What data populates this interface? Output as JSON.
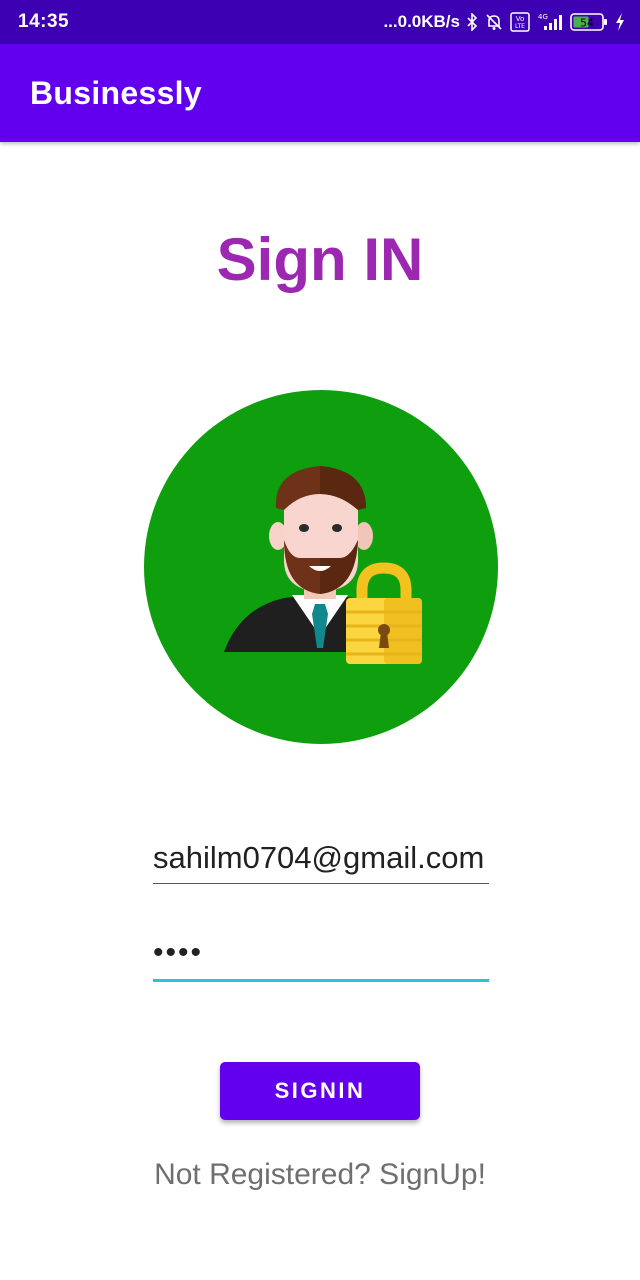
{
  "status_bar": {
    "time": "14:35",
    "net_speed": "...0.0KB/s",
    "battery_level": "54",
    "icons": [
      "bluetooth-icon",
      "silent-bell-icon",
      "volte-icon",
      "4g-signal-icon",
      "battery-icon",
      "charging-icon"
    ]
  },
  "app_bar": {
    "title": "Businessly",
    "color": "#6200ee"
  },
  "main": {
    "title": "Sign IN",
    "title_color": "#9c27b0",
    "avatar_icon": "businessman-lock-icon",
    "avatar_bg": "#0e9e0e",
    "email_value": "sahilm0704@gmail.com",
    "password_value": "••••",
    "signin_label": "SIGNIN",
    "signup_link": "Not Registered? SignUp!"
  }
}
